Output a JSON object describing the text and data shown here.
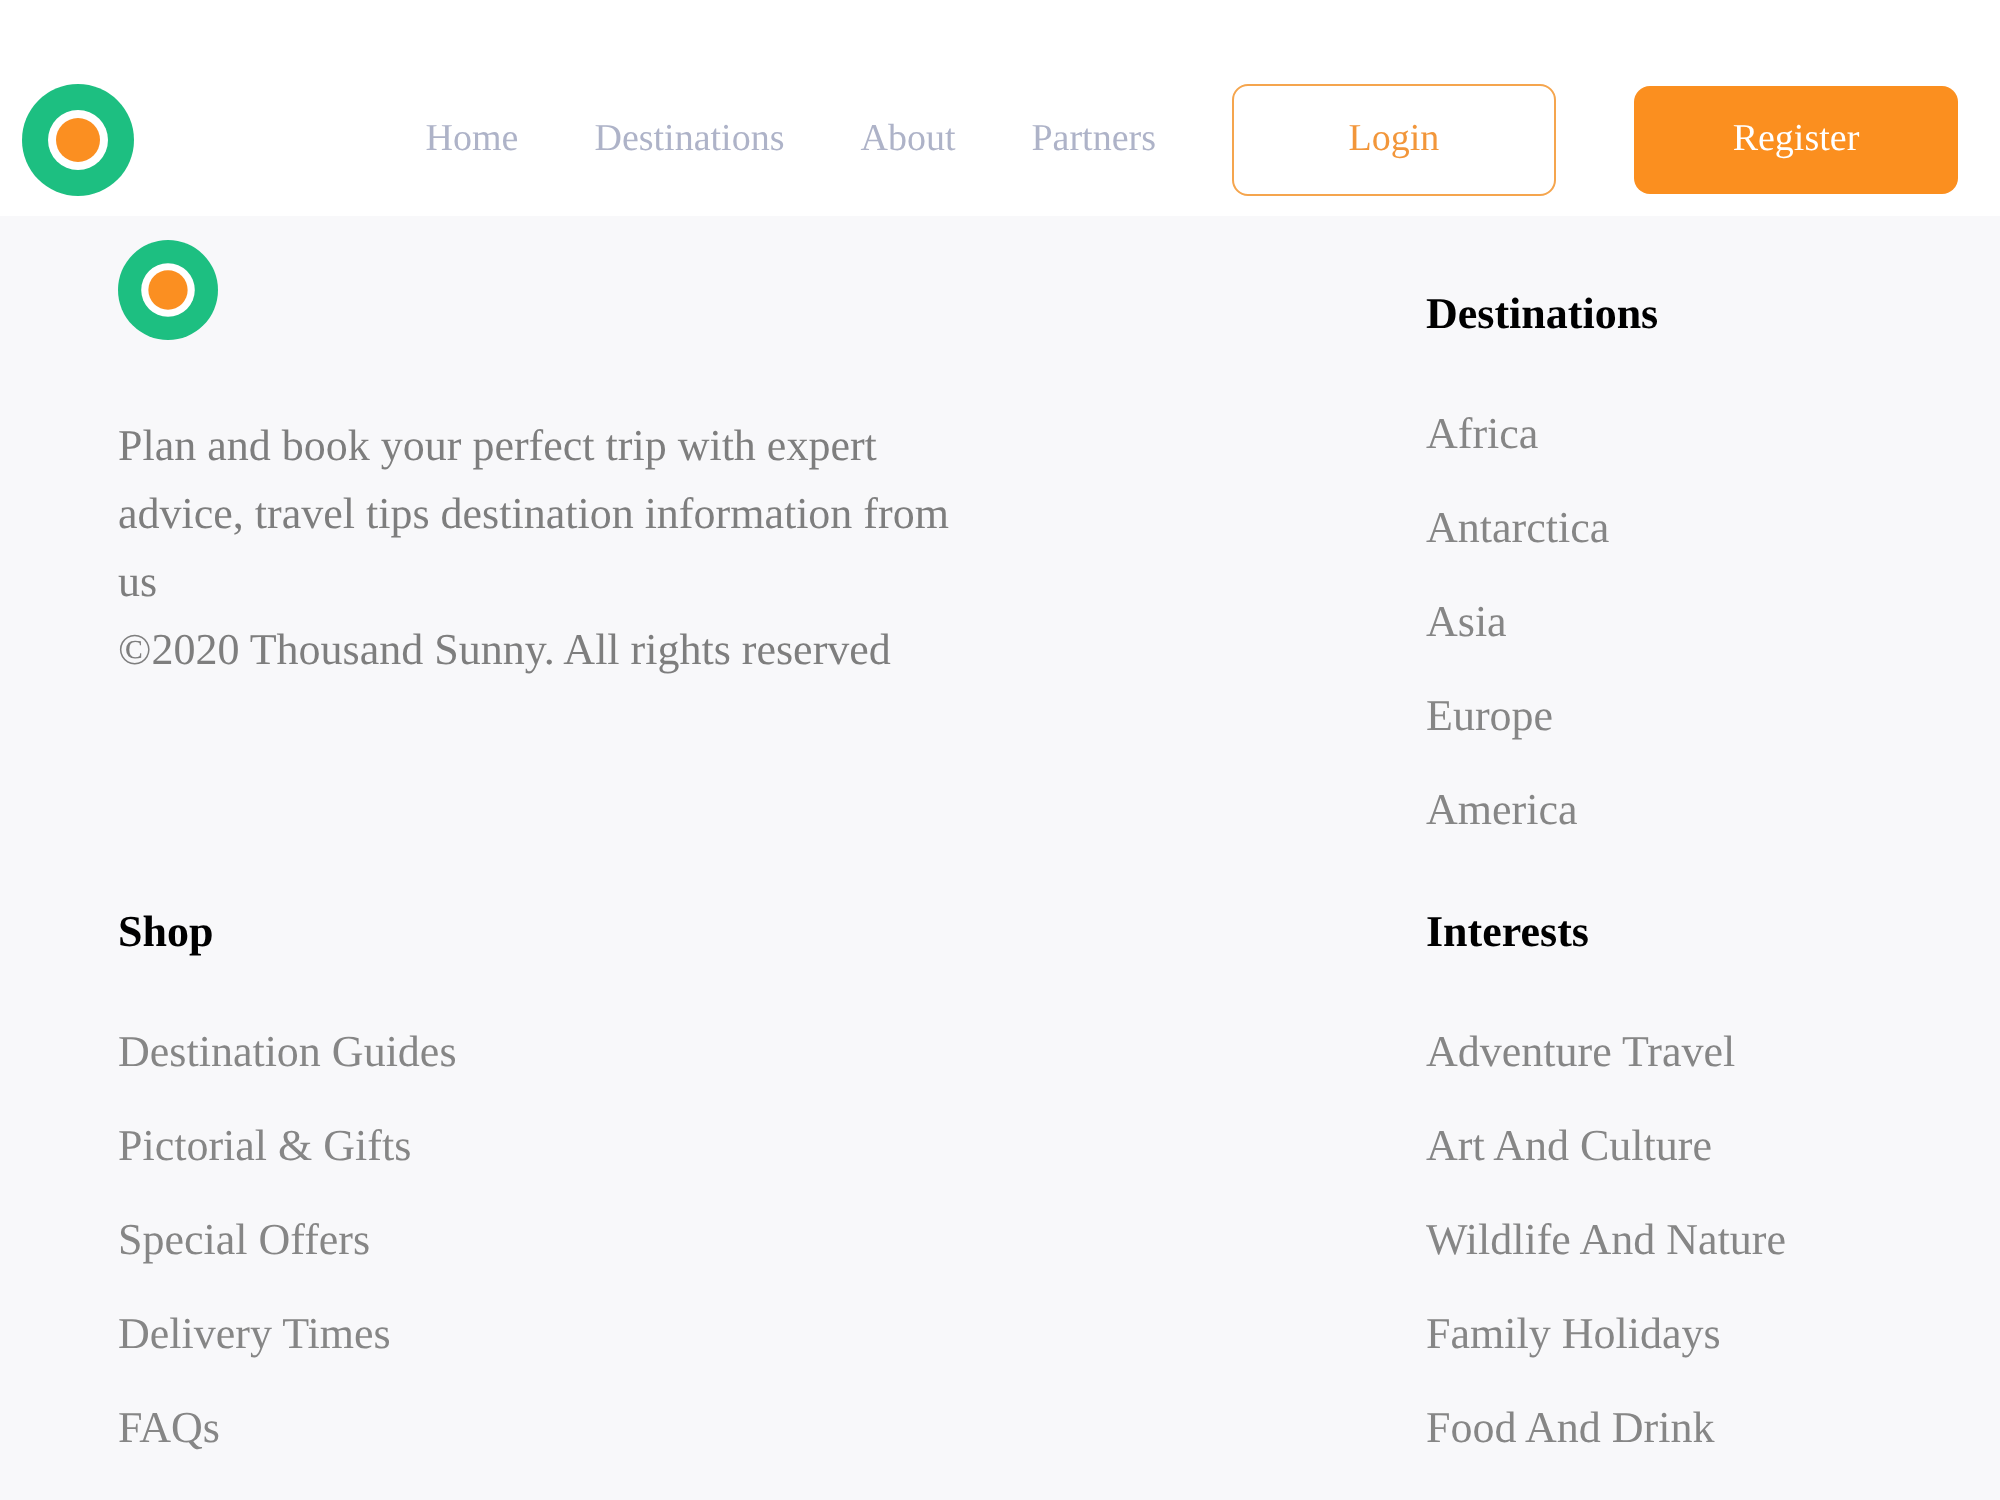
{
  "header": {
    "nav": [
      {
        "label": "Home"
      },
      {
        "label": "Destinations"
      },
      {
        "label": "About"
      },
      {
        "label": "Partners"
      }
    ],
    "buttons": [
      {
        "label": "Login",
        "kind": "outline"
      },
      {
        "label": "Register",
        "kind": "filled"
      }
    ]
  },
  "footer": {
    "about": {
      "text": "Plan and book your perfect trip with expert advice, travel tips destination information from us",
      "copyright": "©2020 Thousand Sunny. All rights reserved"
    },
    "columns": [
      {
        "title": "Destinations",
        "links": [
          "Africa",
          "Antarctica",
          "Asia",
          "Europe",
          "America"
        ]
      },
      {
        "title": "Shop",
        "links": [
          "Destination Guides",
          "Pictorial & Gifts",
          "Special Offers",
          "Delivery Times",
          "FAQs"
        ]
      },
      {
        "title": "Interests",
        "links": [
          "Adventure Travel",
          "Art And Culture",
          "Wildlife And Nature",
          "Family Holidays",
          "Food And Drink"
        ]
      }
    ]
  }
}
